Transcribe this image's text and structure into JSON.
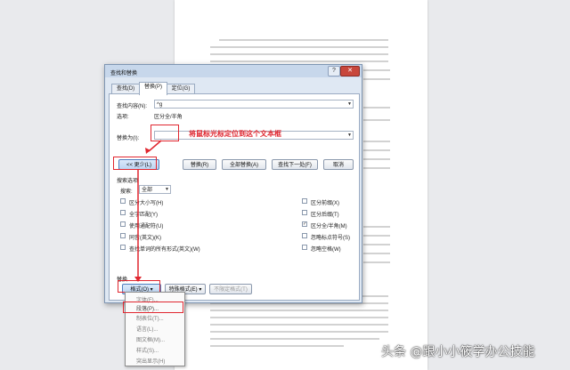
{
  "dialog": {
    "title": "查找和替换",
    "window_buttons": {
      "help": "?",
      "close": "✕"
    },
    "tabs": [
      "查找(D)",
      "替换(P)",
      "定位(G)"
    ],
    "active_tab": "替换(P)",
    "find_label": "查找内容(N):",
    "find_value": "^g",
    "options_label": "选项:",
    "options_value": "区分全/半角",
    "replace_label": "替换为(I):",
    "replace_value": "",
    "buttons": {
      "less": "<< 更少(L)",
      "replace": "替换(R)",
      "replace_all": "全部替换(A)",
      "find_next": "查找下一处(F)",
      "cancel": "取消"
    },
    "search_options_heading": "搜索选项",
    "search_label": "搜索:",
    "search_value": "全部",
    "checkboxes_left": [
      {
        "label": "区分大小写(H)",
        "checked": false,
        "enabled": true
      },
      {
        "label": "全字匹配(Y)",
        "checked": false,
        "enabled": true
      },
      {
        "label": "使用通配符(U)",
        "checked": false,
        "enabled": true
      },
      {
        "label": "同音(英文)(K)",
        "checked": false,
        "enabled": true
      },
      {
        "label": "查找单词的所有形式(英文)(W)",
        "checked": false,
        "enabled": true
      }
    ],
    "checkboxes_right": [
      {
        "label": "区分前缀(X)",
        "checked": false,
        "enabled": true
      },
      {
        "label": "区分后缀(T)",
        "checked": false,
        "enabled": true
      },
      {
        "label": "区分全/半角(M)",
        "checked": true,
        "enabled": true
      },
      {
        "label": "忽略标点符号(S)",
        "checked": false,
        "enabled": true
      },
      {
        "label": "忽略空格(W)",
        "checked": false,
        "enabled": true
      }
    ],
    "replace_section_heading": "替换",
    "format_button": "格式(O) ▾",
    "special_button": "特殊格式(E) ▾",
    "no_format_button": "不限定格式(T)"
  },
  "annotation": "将鼠标光标定位到这个文本框",
  "format_menu": [
    "字体(F)...",
    "段落(P)...",
    "制表位(T)...",
    "语言(L)...",
    "图文框(M)...",
    "样式(S)...",
    "突出显示(H)"
  ],
  "watermark": "头条 @跟小小筱学办公技能",
  "colors": {
    "annotation_red": "#e0262f",
    "dialog_bg": "#dfe8f3",
    "title_bar": "#c7d7eb"
  }
}
